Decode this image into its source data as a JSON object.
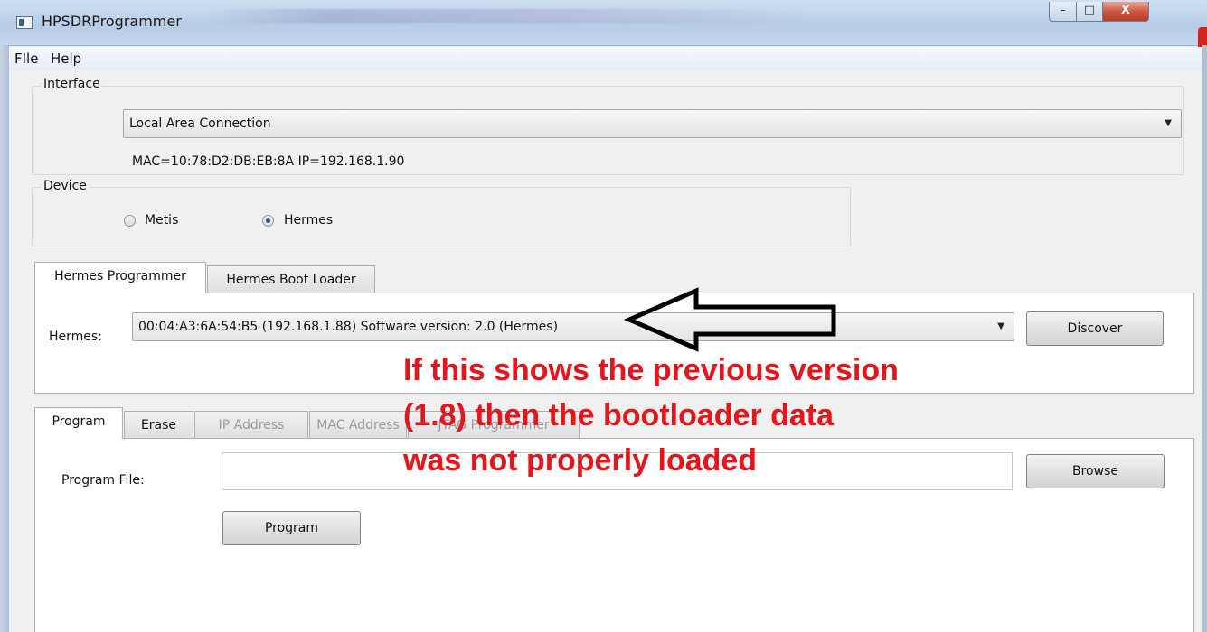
{
  "window": {
    "title": "HPSDRProgrammer",
    "controls": {
      "minimize": "–",
      "maximize": "□",
      "close": "X"
    }
  },
  "menu": [
    "FIle",
    "Help"
  ],
  "interface": {
    "label": "Interface",
    "selected": "Local Area Connection",
    "info": "MAC=10:78:D2:DB:EB:8A  IP=192.168.1.90"
  },
  "device": {
    "label": "Device",
    "options": [
      "Metis",
      "Hermes"
    ],
    "selected": "Hermes"
  },
  "top_tabs": [
    "Hermes Programmer",
    "Hermes Boot Loader"
  ],
  "programmer": {
    "hermes_label": "Hermes:",
    "hermes_selected": "00:04:A3:6A:54:B5 (192.168.1.88) Software version: 2.0 (Hermes)",
    "discover_label": "Discover"
  },
  "bottom_tabs": [
    "Program",
    "Erase",
    "IP Address",
    "MAC Address",
    "JTAG Programmer"
  ],
  "program": {
    "file_label": "Program File:",
    "file_value": "",
    "browse_label": "Browse",
    "program_button": "Program"
  },
  "annotation": {
    "lines": [
      "If this shows the previous version",
      "(1.8) then the bootloader data",
      "was not properly loaded"
    ],
    "color": "#e4151b"
  },
  "icons": {
    "app": "app-window-icon",
    "dropdown": "chevron-down-icon",
    "arrow": "left-arrow-annotation"
  }
}
